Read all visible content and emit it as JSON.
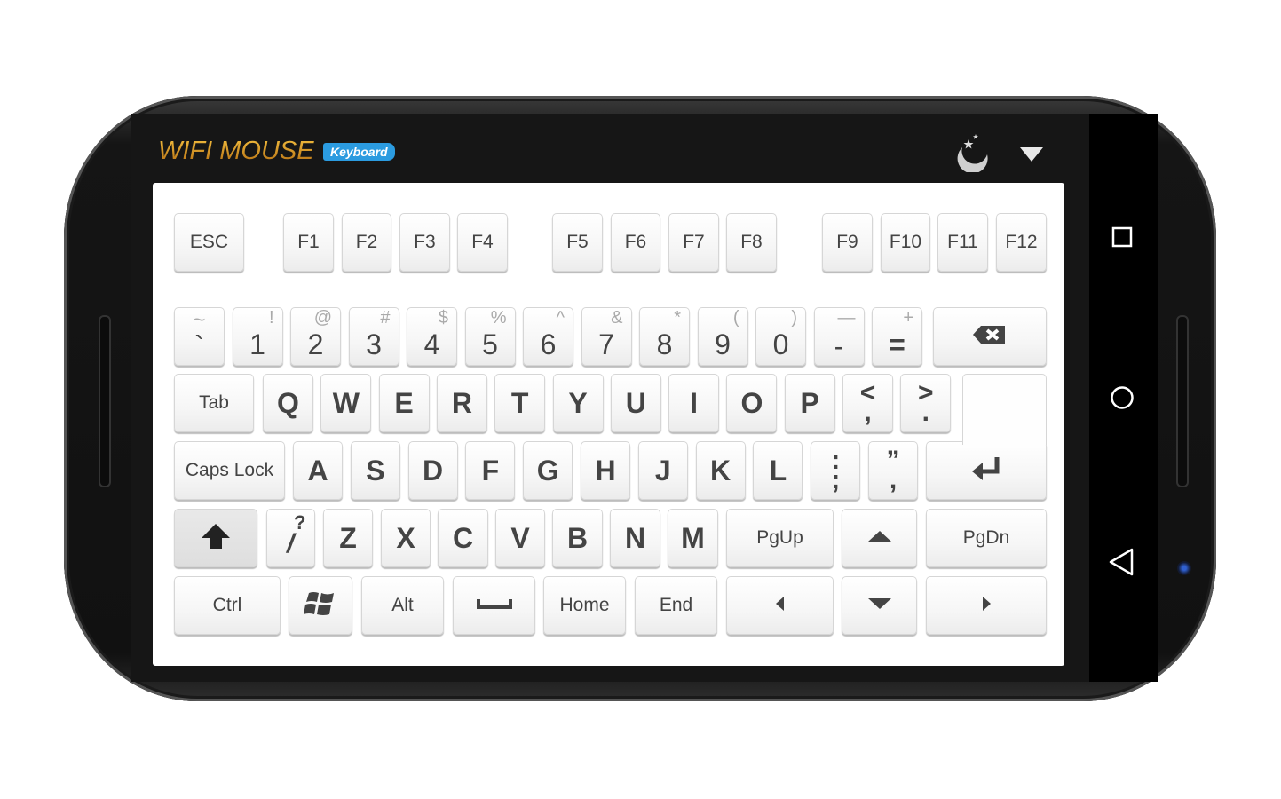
{
  "app": {
    "logo": "WIFI MOUSE",
    "badge": "Keyboard"
  },
  "header_icons": [
    "night-mode-moon-icon",
    "dropdown-menu-triangle-icon"
  ],
  "android_nav": [
    "recent-apps-square-icon",
    "home-circle-icon",
    "back-triangle-icon"
  ],
  "colors": {
    "accent": "#2b9be0",
    "logo_gold": "#e0a020",
    "key_text": "#444444",
    "shifted_text": "#aaaaaa"
  },
  "keys": {
    "function_row": [
      {
        "label": "ESC"
      },
      {
        "label": "F1"
      },
      {
        "label": "F2"
      },
      {
        "label": "F3"
      },
      {
        "label": "F4"
      },
      {
        "label": "F5"
      },
      {
        "label": "F6"
      },
      {
        "label": "F7"
      },
      {
        "label": "F8"
      },
      {
        "label": "F9"
      },
      {
        "label": "F10"
      },
      {
        "label": "F11"
      },
      {
        "label": "F12"
      }
    ],
    "number_row": [
      {
        "label": "`",
        "shift": "~"
      },
      {
        "label": "1",
        "shift": "!"
      },
      {
        "label": "2",
        "shift": "@"
      },
      {
        "label": "3",
        "shift": "#"
      },
      {
        "label": "4",
        "shift": "$"
      },
      {
        "label": "5",
        "shift": "%"
      },
      {
        "label": "6",
        "shift": "^"
      },
      {
        "label": "7",
        "shift": "&"
      },
      {
        "label": "8",
        "shift": "*"
      },
      {
        "label": "9",
        "shift": "("
      },
      {
        "label": "0",
        "shift": ")"
      },
      {
        "label": "-",
        "shift": "—"
      },
      {
        "label": "=",
        "shift": "+"
      },
      {
        "icon": "backspace-icon"
      }
    ],
    "qwerty_row": [
      {
        "label": "Tab"
      },
      {
        "label": "Q"
      },
      {
        "label": "W"
      },
      {
        "label": "E"
      },
      {
        "label": "R"
      },
      {
        "label": "T"
      },
      {
        "label": "Y"
      },
      {
        "label": "U"
      },
      {
        "label": "I"
      },
      {
        "label": "O"
      },
      {
        "label": "P"
      },
      {
        "label": ",",
        "shift": "<"
      },
      {
        "label": ".",
        "shift": ">"
      }
    ],
    "home_row": [
      {
        "label": "Caps Lock"
      },
      {
        "label": "A"
      },
      {
        "label": "S"
      },
      {
        "label": "D"
      },
      {
        "label": "F"
      },
      {
        "label": "G"
      },
      {
        "label": "H"
      },
      {
        "label": "J"
      },
      {
        "label": "K"
      },
      {
        "label": "L"
      },
      {
        "label": ";",
        "shift": ":"
      },
      {
        "label": ",",
        "shift": "”"
      },
      {
        "icon": "enter-icon"
      }
    ],
    "shift_row": [
      {
        "icon": "shift-icon"
      },
      {
        "label": "/",
        "shift": "?"
      },
      {
        "label": "Z"
      },
      {
        "label": "X"
      },
      {
        "label": "C"
      },
      {
        "label": "V"
      },
      {
        "label": "B"
      },
      {
        "label": "N"
      },
      {
        "label": "M"
      },
      {
        "label": "PgUp"
      },
      {
        "icon": "arrow-up-icon"
      },
      {
        "label": "PgDn"
      }
    ],
    "bottom_row": [
      {
        "label": "Ctrl"
      },
      {
        "icon": "windows-icon"
      },
      {
        "label": "Alt"
      },
      {
        "icon": "space-icon"
      },
      {
        "label": "Home"
      },
      {
        "label": "End"
      },
      {
        "icon": "arrow-left-icon"
      },
      {
        "icon": "arrow-down-icon"
      },
      {
        "icon": "arrow-right-icon"
      }
    ]
  }
}
